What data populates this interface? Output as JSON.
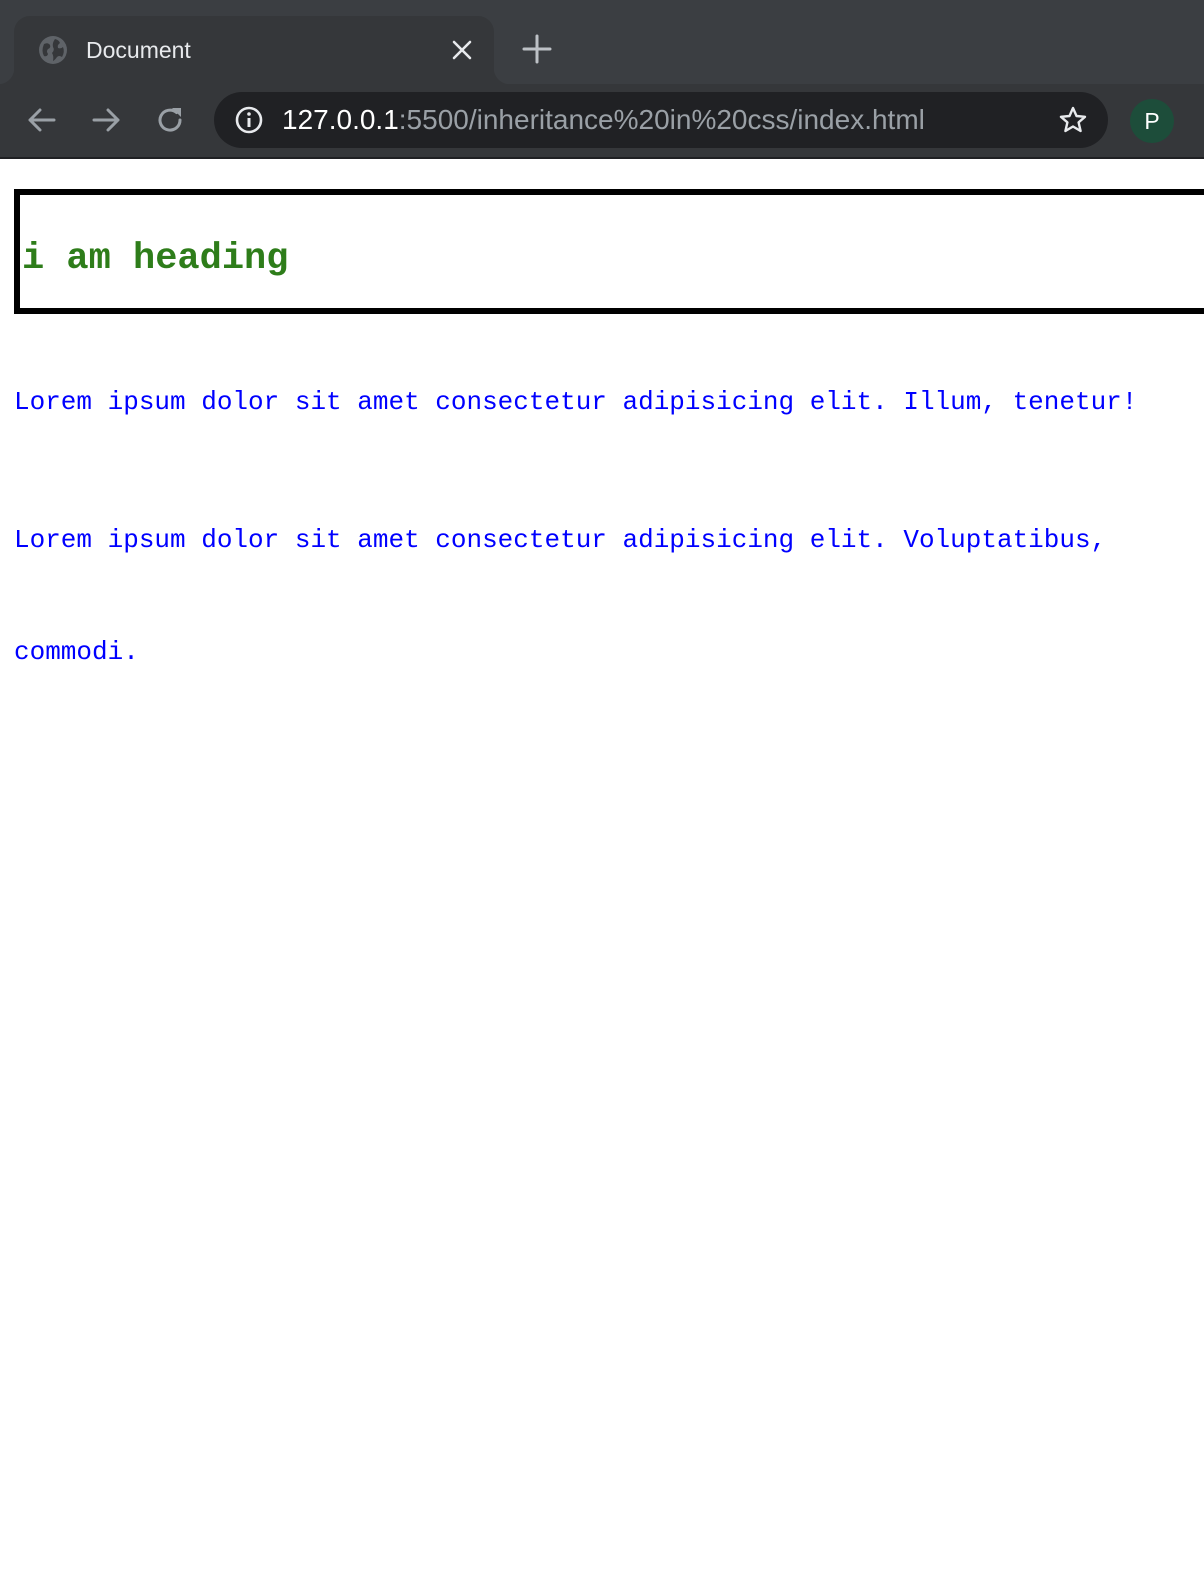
{
  "browser": {
    "tab": {
      "title": "Document"
    },
    "address_bar": {
      "url_host": "127.0.0.1",
      "url_rest": ":5500/inheritance%20in%20css/index.html"
    },
    "profile": {
      "initial": "P",
      "color": "#1d4d3a"
    },
    "icons": {
      "favicon": "globe-icon",
      "tab_close": "close-icon",
      "new_tab": "plus-icon",
      "back": "arrow-left-icon",
      "forward": "arrow-right-icon",
      "reload": "reload-icon",
      "site_info": "info-icon",
      "bookmark": "star-icon"
    }
  },
  "page": {
    "heading": "i am heading",
    "heading_color": "#2e7d1a",
    "paragraph_color": "#0000ff",
    "paragraph_1": "Lorem ipsum dolor sit amet consectetur adipisicing elit. Illum, tenetur!",
    "paragraph_2_line_1": "Lorem ipsum dolor sit amet consectetur adipisicing elit. Voluptatibus,",
    "paragraph_2_line_2": "commodi."
  }
}
